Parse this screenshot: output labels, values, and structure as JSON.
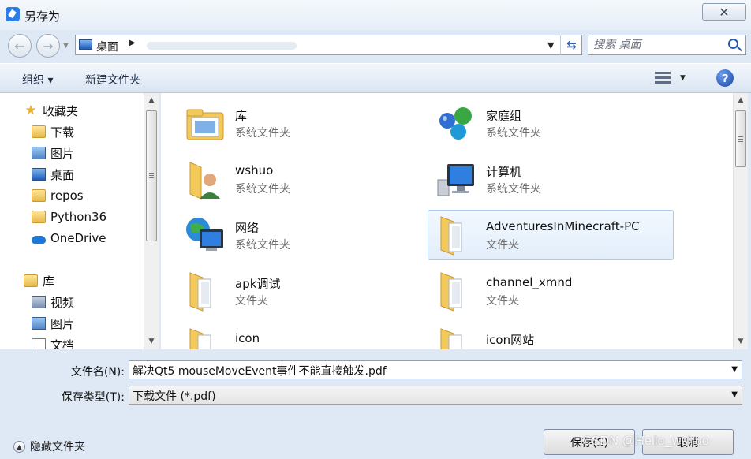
{
  "window": {
    "title": "另存为"
  },
  "address": {
    "location": "桌面"
  },
  "search": {
    "placeholder": "搜索 桌面"
  },
  "toolbar": {
    "organize": "组织 ▾",
    "new_folder": "新建文件夹"
  },
  "sidebar": {
    "favorites": {
      "label": "收藏夹",
      "items": [
        {
          "label": "下载",
          "icon": "download-folder-icon"
        },
        {
          "label": "图片",
          "icon": "pictures-icon"
        },
        {
          "label": "桌面",
          "icon": "desktop-icon"
        },
        {
          "label": "repos",
          "icon": "folder-icon"
        },
        {
          "label": "Python36",
          "icon": "folder-icon"
        },
        {
          "label": "OneDrive",
          "icon": "onedrive-icon"
        }
      ]
    },
    "libraries": {
      "label": "库",
      "items": [
        {
          "label": "视频",
          "icon": "videos-icon"
        },
        {
          "label": "图片",
          "icon": "pictures-icon"
        },
        {
          "label": "文档",
          "icon": "documents-icon"
        }
      ]
    }
  },
  "files": [
    {
      "name": "库",
      "type": "系统文件夹",
      "icon": "library-icon"
    },
    {
      "name": "家庭组",
      "type": "系统文件夹",
      "icon": "homegroup-icon"
    },
    {
      "name": "wshuo",
      "type": "系统文件夹",
      "icon": "user-folder-icon"
    },
    {
      "name": "计算机",
      "type": "系统文件夹",
      "icon": "computer-icon"
    },
    {
      "name": "网络",
      "type": "系统文件夹",
      "icon": "network-icon"
    },
    {
      "name": "AdventuresInMinecraft-PC",
      "type": "文件夹",
      "icon": "folder-icon"
    },
    {
      "name": "apk调试",
      "type": "文件夹",
      "icon": "folder-icon"
    },
    {
      "name": "channel_xmnd",
      "type": "文件夹",
      "icon": "folder-icon"
    },
    {
      "name": "icon",
      "type": "",
      "icon": "folder-icon"
    },
    {
      "name": "icon网站",
      "type": "",
      "icon": "folder-icon"
    }
  ],
  "form": {
    "filename_label": "文件名(N):",
    "filename_value": "解决Qt5 mouseMoveEvent事件不能直接触发.pdf",
    "filetype_label": "保存类型(T):",
    "filetype_value": "下载文件 (*.pdf)"
  },
  "footer": {
    "hide_folders": "隐藏文件夹",
    "save_button": "保存(S)",
    "cancel_button": "取消"
  },
  "watermark": "CSDN @Hello_wshuo"
}
